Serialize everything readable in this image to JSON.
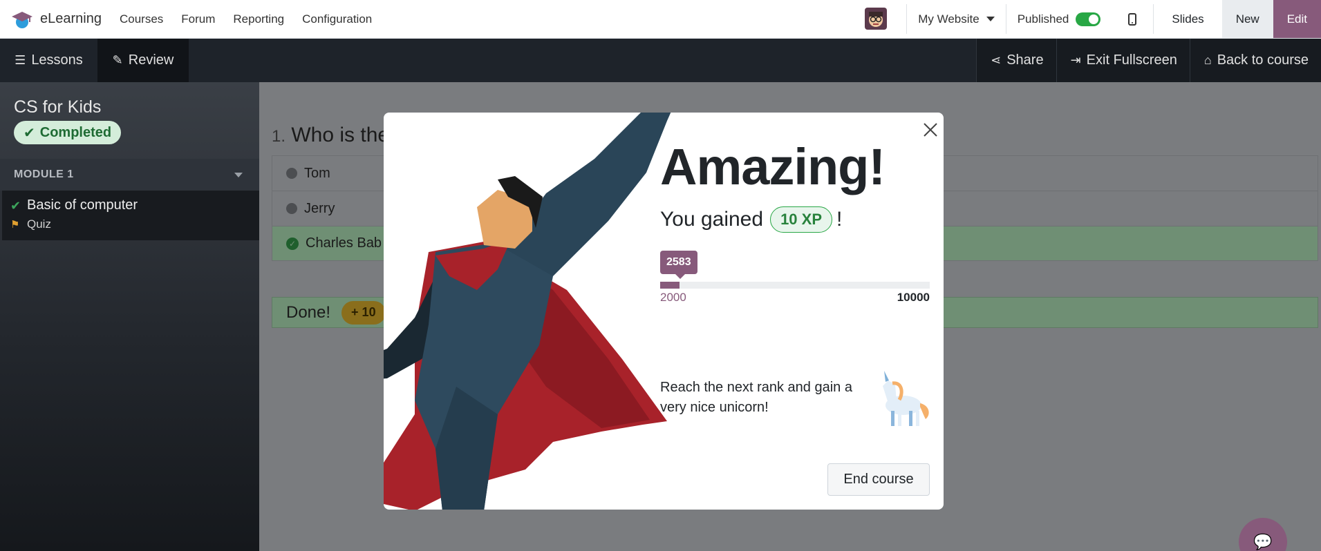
{
  "app": {
    "name": "eLearning",
    "menu": [
      "Courses",
      "Forum",
      "Reporting",
      "Configuration"
    ]
  },
  "topbar": {
    "website": "My Website",
    "published_label": "Published",
    "published": true,
    "slides": "Slides",
    "new": "New",
    "edit": "Edit"
  },
  "fullscreen": {
    "lessons": "Lessons",
    "review": "Review",
    "share": "Share",
    "exit": "Exit Fullscreen",
    "back": "Back to course"
  },
  "sidebar": {
    "course_title": "CS for Kids",
    "status": "Completed",
    "module": "MODULE 1",
    "lesson": "Basic of computer",
    "quiz": "Quiz"
  },
  "quiz": {
    "number": "1.",
    "question": "Who is the",
    "answers": [
      {
        "label": "Tom",
        "correct": false
      },
      {
        "label": "Jerry",
        "correct": false
      },
      {
        "label": "Charles Bab",
        "correct": true
      }
    ],
    "done": "Done!",
    "done_xp": "+ 10"
  },
  "modal": {
    "heading": "Amazing!",
    "gained_prefix": "You gained",
    "xp": "10 XP",
    "gained_suffix": "!",
    "current_xp": "2583",
    "range_min": "2000",
    "range_max": "10000",
    "progress_fraction": 0.073,
    "next_rank_text": "Reach the next rank and gain a very nice unicorn!",
    "end_button": "End course"
  },
  "colors": {
    "brand": "#875a7b",
    "success": "#28a745",
    "published_toggle": "#28a745"
  },
  "icons": {
    "lessons": "bars-icon",
    "review": "pencil-icon",
    "share": "share-icon",
    "exit": "sign-out-icon",
    "back": "home-icon",
    "fab": "chat-icon"
  }
}
